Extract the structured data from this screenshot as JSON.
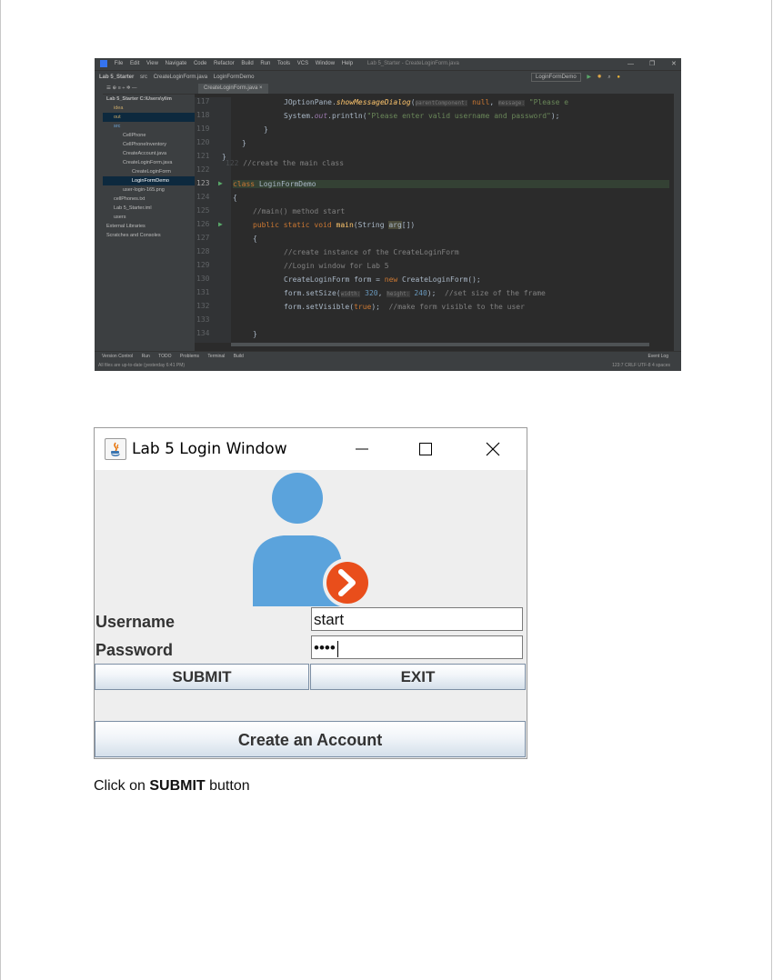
{
  "ide": {
    "menu": [
      "File",
      "Edit",
      "View",
      "Navigate",
      "Code",
      "Refactor",
      "Build",
      "Run",
      "Tools",
      "VCS",
      "Window",
      "Help"
    ],
    "window_title": "Lab 5_Starter - CreateLoginForm.java",
    "breadcrumbs": [
      "Lab 5_Starter",
      "src",
      "CreateLoginForm.java",
      "LoginFormDemo"
    ],
    "run_config": "LoginFormDemo",
    "tab": "CreateLoginForm.java",
    "project_header": "Project",
    "tree": [
      "Lab 5_Starter  C:\\Users\\ylim",
      "idea",
      "out",
      "src",
      "CellPhone",
      "CellPhoneInventory",
      "CreateAccount.java",
      "CreateLoginForm.java",
      "CreateLoginForm",
      "LoginFormDemo",
      "user-login-165.png",
      "cellPhones.txt",
      "Lab 5_Starter.iml",
      "users",
      "External Libraries",
      "Scratches and Consoles"
    ],
    "line_numbers": [
      "117",
      "118",
      "119",
      "120",
      "121",
      "122",
      "123",
      "124",
      "125",
      "126",
      "127",
      "128",
      "129",
      "130",
      "131",
      "132",
      "133",
      "134"
    ],
    "code": {
      "l117_a": "JOptionPane.",
      "l117_b": "showMessageDialog",
      "l117_c": "(",
      "l117_hint1": "parentComponent:",
      "l117_null": " null",
      "l117_d": ", ",
      "l117_hint2": "message:",
      "l117_e": " \"Please e",
      "l118_a": "System.",
      "l118_b": "out",
      "l118_c": ".println(",
      "l118_d": "\"Please enter valid username and password\"",
      "l118_e": ");",
      "l119": "}",
      "l120": "}",
      "l121": "}",
      "l122": "//create the main class",
      "l123_kw": "class",
      "l123_name": " LoginFormDemo",
      "l124": "{",
      "l125": "//main() method start",
      "l126_kw": "public static void",
      "l126_fn": " main",
      "l126_a": "(String ",
      "l126_arg": "arg",
      "l126_b": "[])",
      "l127": "{",
      "l128": "//create instance of the CreateLoginForm",
      "l129": "//Login window for Lab 5",
      "l130_a": "CreateLoginForm form = ",
      "l130_kw": "new",
      "l130_b": " CreateLoginForm();",
      "l131_a": "form.setSize(",
      "l131_hint1": "width:",
      "l131_n1": " 320",
      "l131_b": ", ",
      "l131_hint2": "height:",
      "l131_n2": " 240",
      "l131_c": ");  ",
      "l131_cm": "//set size of the frame",
      "l132_a": "form.setVisible(",
      "l132_kw": "true",
      "l132_b": ");  ",
      "l132_cm": "//make form visible to the user",
      "l134": "}"
    },
    "bottom_tools": [
      "Version Control",
      "Run",
      "TODO",
      "Problems",
      "Terminal",
      "Build"
    ],
    "event_log": "Event Log",
    "status_left": "All files are up-to-date (yesterday 6:41 PM)",
    "status_right": "123:7   CRLF   UTF-8   4 spaces"
  },
  "login": {
    "title": "Lab 5 Login Window",
    "username_label": "Username",
    "username_value": "start",
    "password_label": "Password",
    "password_value": "••••",
    "submit_label": "SUBMIT",
    "exit_label": "EXIT",
    "create_label": "Create an Account"
  },
  "caption": {
    "prefix": "Click on ",
    "bold": "SUBMIT",
    "suffix": " button"
  },
  "colors": {
    "avatar_blue": "#5ba3dc",
    "arrow_orange": "#e94e1b",
    "ide_background": "#2b2b2b"
  }
}
